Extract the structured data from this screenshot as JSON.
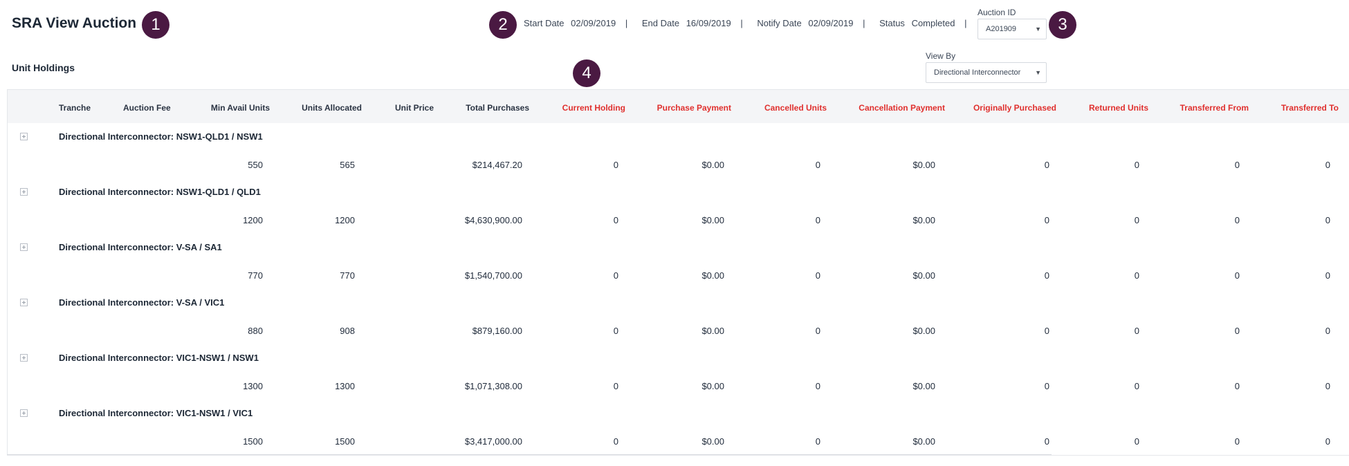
{
  "header": {
    "title": "SRA View Auction",
    "start_date_label": "Start Date",
    "start_date": "02/09/2019",
    "end_date_label": "End Date",
    "end_date": "16/09/2019",
    "notify_date_label": "Notify Date",
    "notify_date": "02/09/2019",
    "status_label": "Status",
    "status": "Completed",
    "separator": "|",
    "auction_id_label": "Auction ID",
    "auction_id_value": "A201909"
  },
  "callouts": [
    "1",
    "2",
    "3",
    "4"
  ],
  "unit_holdings": {
    "title": "Unit Holdings",
    "view_by_label": "View By",
    "view_by_value": "Directional Interconnector"
  },
  "icons": {
    "dropdown": "chevron-down-icon",
    "expand": "plus-square-icon"
  },
  "colors": {
    "callout_bg": "#4a1942",
    "highlight_header": "#e0302e"
  },
  "columns": [
    "Tranche",
    "Auction Fee",
    "Min Avail Units",
    "Units Allocated",
    "Unit Price",
    "Total Purchases",
    "Current Holding",
    "Purchase Payment",
    "Cancelled Units",
    "Cancellation Payment",
    "Originally Purchased",
    "Returned Units",
    "Transferred From",
    "Transferred To"
  ],
  "groups": [
    {
      "label": "Directional Interconnector: NSW1-QLD1 / NSW1",
      "row": [
        "",
        "",
        "550",
        "565",
        "",
        "$214,467.20",
        "0",
        "$0.00",
        "0",
        "$0.00",
        "0",
        "0",
        "0",
        "0"
      ]
    },
    {
      "label": "Directional Interconnector: NSW1-QLD1 / QLD1",
      "row": [
        "",
        "",
        "1200",
        "1200",
        "",
        "$4,630,900.00",
        "0",
        "$0.00",
        "0",
        "$0.00",
        "0",
        "0",
        "0",
        "0"
      ]
    },
    {
      "label": "Directional Interconnector: V-SA / SA1",
      "row": [
        "",
        "",
        "770",
        "770",
        "",
        "$1,540,700.00",
        "0",
        "$0.00",
        "0",
        "$0.00",
        "0",
        "0",
        "0",
        "0"
      ]
    },
    {
      "label": "Directional Interconnector: V-SA / VIC1",
      "row": [
        "",
        "",
        "880",
        "908",
        "",
        "$879,160.00",
        "0",
        "$0.00",
        "0",
        "$0.00",
        "0",
        "0",
        "0",
        "0"
      ]
    },
    {
      "label": "Directional Interconnector: VIC1-NSW1 / NSW1",
      "row": [
        "",
        "",
        "1300",
        "1300",
        "",
        "$1,071,308.00",
        "0",
        "$0.00",
        "0",
        "$0.00",
        "0",
        "0",
        "0",
        "0"
      ]
    },
    {
      "label": "Directional Interconnector: VIC1-NSW1 / VIC1",
      "row": [
        "",
        "",
        "1500",
        "1500",
        "",
        "$3,417,000.00",
        "0",
        "$0.00",
        "0",
        "$0.00",
        "0",
        "0",
        "0",
        "0"
      ]
    }
  ]
}
